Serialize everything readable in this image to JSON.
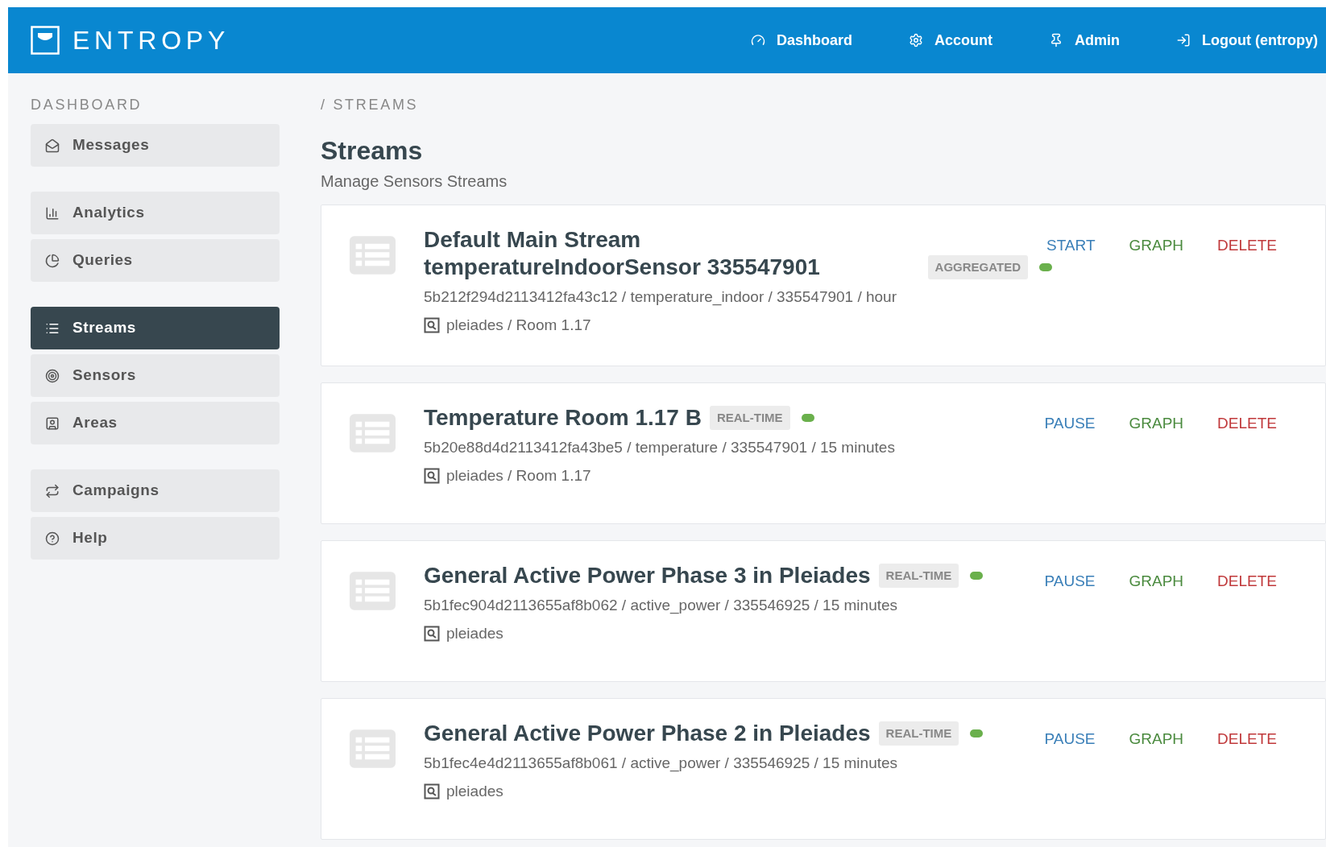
{
  "header": {
    "logo": "ENTROPY",
    "nav": [
      {
        "label": "Dashboard"
      },
      {
        "label": "Account"
      },
      {
        "label": "Admin"
      },
      {
        "label": "Logout (entropy)"
      }
    ]
  },
  "sidebar": {
    "title": "DASHBOARD",
    "groups": [
      [
        {
          "label": "Messages",
          "selected": false
        }
      ],
      [
        {
          "label": "Analytics",
          "selected": false
        },
        {
          "label": "Queries",
          "selected": false
        }
      ],
      [
        {
          "label": "Streams",
          "selected": true
        },
        {
          "label": "Sensors",
          "selected": false
        },
        {
          "label": "Areas",
          "selected": false
        }
      ],
      [
        {
          "label": "Campaigns",
          "selected": false
        },
        {
          "label": "Help",
          "selected": false
        }
      ]
    ]
  },
  "breadcrumb": "/ STREAMS",
  "page_title": "Streams",
  "page_subtitle": "Manage Sensors Streams",
  "streams": [
    {
      "title": "Default Main Stream temperatureIndoorSensor 335547901",
      "badge": "AGGREGATED",
      "active": true,
      "details": "5b212f294d2113412fa43c12 / temperature_indoor / 335547901 / hour",
      "location": "pleiades / Room 1.17",
      "actions": [
        {
          "kind": "start",
          "label": "START"
        },
        {
          "kind": "graph",
          "label": "GRAPH"
        },
        {
          "kind": "delete",
          "label": "DELETE"
        }
      ]
    },
    {
      "title": "Temperature Room 1.17 B",
      "badge": "REAL-TIME",
      "active": true,
      "details": "5b20e88d4d2113412fa43be5 / temperature / 335547901 / 15 minutes",
      "location": "pleiades / Room 1.17",
      "actions": [
        {
          "kind": "pause",
          "label": "PAUSE"
        },
        {
          "kind": "graph",
          "label": "GRAPH"
        },
        {
          "kind": "delete",
          "label": "DELETE"
        }
      ]
    },
    {
      "title": "General Active Power Phase 3 in Pleiades",
      "badge": "REAL-TIME",
      "active": true,
      "details": "5b1fec904d2113655af8b062 / active_power / 335546925 / 15 minutes",
      "location": "pleiades",
      "actions": [
        {
          "kind": "pause",
          "label": "PAUSE"
        },
        {
          "kind": "graph",
          "label": "GRAPH"
        },
        {
          "kind": "delete",
          "label": "DELETE"
        }
      ]
    },
    {
      "title": "General Active Power Phase 2 in Pleiades",
      "badge": "REAL-TIME",
      "active": true,
      "details": "5b1fec4e4d2113655af8b061 / active_power / 335546925 / 15 minutes",
      "location": "pleiades",
      "actions": [
        {
          "kind": "pause",
          "label": "PAUSE"
        },
        {
          "kind": "graph",
          "label": "GRAPH"
        },
        {
          "kind": "delete",
          "label": "DELETE"
        }
      ]
    }
  ]
}
